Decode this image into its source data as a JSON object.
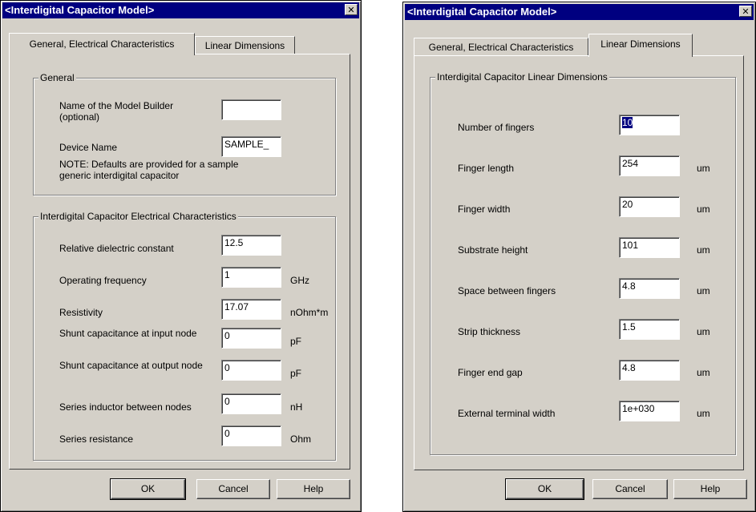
{
  "left": {
    "title": "<Interdigital Capacitor Model>",
    "tabs": [
      "General, Electrical Characteristics",
      "Linear Dimensions"
    ],
    "general": {
      "legend": "General",
      "builder_label": "Name of the Model Builder (optional)",
      "builder_value": "",
      "device_label": "Device Name",
      "device_value": "SAMPLE_",
      "note": "NOTE: Defaults are provided for a sample generic interdigital capacitor"
    },
    "electrical": {
      "legend": "Interdigital Capacitor Electrical Characteristics",
      "rows": [
        {
          "label": "Relative dielectric constant",
          "value": "12.5",
          "unit": ""
        },
        {
          "label": "Operating frequency",
          "value": "1",
          "unit": "GHz"
        },
        {
          "label": "Resistivity",
          "value": "17.07",
          "unit": "nOhm*m"
        },
        {
          "label": "Shunt capacitance at input node",
          "value": "0",
          "unit": "pF"
        },
        {
          "label": "Shunt capacitance at output node",
          "value": "0",
          "unit": "pF"
        },
        {
          "label": "Series inductor between nodes",
          "value": "0",
          "unit": "nH"
        },
        {
          "label": "Series resistance",
          "value": "0",
          "unit": "Ohm"
        }
      ]
    },
    "buttons": {
      "ok": "OK",
      "cancel": "Cancel",
      "help": "Help"
    }
  },
  "right": {
    "title": "<Interdigital Capacitor Model>",
    "tabs": [
      "General, Electrical Characteristics",
      "Linear Dimensions"
    ],
    "group": {
      "legend": "Interdigital Capacitor Linear Dimensions",
      "rows": [
        {
          "label": "Number of fingers",
          "value": "10",
          "unit": ""
        },
        {
          "label": "Finger length",
          "value": "254",
          "unit": "um"
        },
        {
          "label": "Finger width",
          "value": "20",
          "unit": "um"
        },
        {
          "label": "Substrate height",
          "value": "101",
          "unit": "um"
        },
        {
          "label": "Space between fingers",
          "value": "4.8",
          "unit": "um"
        },
        {
          "label": "Strip thickness",
          "value": "1.5",
          "unit": "um"
        },
        {
          "label": "Finger end gap",
          "value": "4.8",
          "unit": "um"
        },
        {
          "label": "External terminal width",
          "value": "1e+030",
          "unit": "um"
        }
      ]
    },
    "buttons": {
      "ok": "OK",
      "cancel": "Cancel",
      "help": "Help"
    }
  },
  "icons": {
    "close": "close-icon"
  }
}
